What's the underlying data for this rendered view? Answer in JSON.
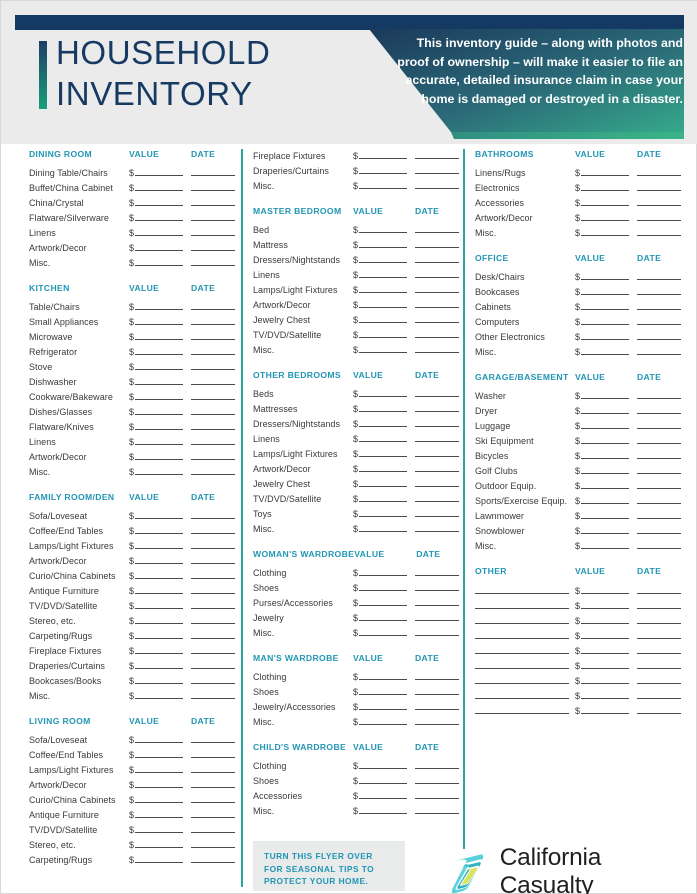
{
  "header": {
    "title_lines": [
      "HOUSEHOLD",
      "INVENTORY"
    ],
    "promo_text": "This inventory guide – along with photos and proof of ownership – will make it easier to file an accurate, detailed insurance claim in case your home is damaged or destroyed in a disaster.",
    "colors": {
      "band": "#ebebeb",
      "topbar_navy": "#143a64",
      "title_navy": "#173a63",
      "accent_teal": "#2aa79b",
      "section_blue": "#2196b4",
      "promo_gradient_start": "#1b3a5c",
      "promo_gradient_end": "#32a086"
    }
  },
  "table_headers": {
    "value": "VALUE",
    "date": "DATE"
  },
  "money_symbol": "$",
  "columns": [
    {
      "id": "column-1",
      "sections": [
        {
          "title": "DINING ROOM",
          "show_headers": true,
          "items": [
            "Dining Table/Chairs",
            "Buffet/China Cabinet",
            "China/Crystal",
            "Flatware/Silverware",
            "Linens",
            "Artwork/Decor",
            "Misc."
          ]
        },
        {
          "title": "KITCHEN",
          "show_headers": true,
          "items": [
            "Table/Chairs",
            "Small Appliances",
            "Microwave",
            "Refrigerator",
            "Stove",
            "Dishwasher",
            "Cookware/Bakeware",
            "Dishes/Glasses",
            "Flatware/Knives",
            "Linens",
            "Artwork/Decor",
            "Misc."
          ]
        },
        {
          "title": "FAMILY ROOM/DEN",
          "show_headers": true,
          "items": [
            "Sofa/Loveseat",
            "Coffee/End Tables",
            "Lamps/Light Fixtures",
            "Artwork/Decor",
            "Curio/China Cabinets",
            "Antique Furniture",
            "TV/DVD/Satellite",
            "Stereo, etc.",
            "Carpeting/Rugs",
            "Fireplace Fixtures",
            "Draperies/Curtains",
            "Bookcases/Books",
            "Misc."
          ]
        },
        {
          "title": "LIVING ROOM",
          "show_headers": true,
          "items": [
            "Sofa/Loveseat",
            "Coffee/End Tables",
            "Lamps/Light Fixtures",
            "Artwork/Decor",
            "Curio/China Cabinets",
            "Antique Furniture",
            "TV/DVD/Satellite",
            "Stereo, etc.",
            "Carpeting/Rugs"
          ]
        }
      ]
    },
    {
      "id": "column-2",
      "sections": [
        {
          "title": "",
          "show_headers": false,
          "items": [
            "Fireplace Fixtures",
            "Draperies/Curtains",
            "Misc."
          ]
        },
        {
          "title": "MASTER BEDROOM",
          "show_headers": true,
          "items": [
            "Bed",
            "Mattress",
            "Dressers/Nightstands",
            "Linens",
            "Lamps/Light Fixtures",
            "Artwork/Decor",
            "Jewelry Chest",
            "TV/DVD/Satellite",
            "Misc."
          ]
        },
        {
          "title": "OTHER BEDROOMS",
          "show_headers": true,
          "items": [
            "Beds",
            "Mattresses",
            "Dressers/Nightstands",
            "Linens",
            "Lamps/Light Fixtures",
            "Artwork/Decor",
            "Jewelry Chest",
            "TV/DVD/Satellite",
            "Toys",
            "Misc."
          ]
        },
        {
          "title": "WOMAN'S WARDROBE",
          "show_headers": true,
          "items": [
            "Clothing",
            "Shoes",
            "Purses/Accessories",
            "Jewelry",
            "Misc."
          ]
        },
        {
          "title": "MAN'S WARDROBE",
          "show_headers": true,
          "items": [
            "Clothing",
            "Shoes",
            "Jewelry/Accessories",
            "Misc."
          ]
        },
        {
          "title": "CHILD'S WARDROBE",
          "show_headers": true,
          "items": [
            "Clothing",
            "Shoes",
            "Accessories",
            "Misc."
          ]
        }
      ]
    },
    {
      "id": "column-3",
      "sections": [
        {
          "title": "BATHROOMS",
          "show_headers": true,
          "items": [
            "Linens/Rugs",
            "Electronics",
            "Accessories",
            "Artwork/Decor",
            "Misc."
          ]
        },
        {
          "title": "OFFICE",
          "show_headers": true,
          "items": [
            "Desk/Chairs",
            "Bookcases",
            "Cabinets",
            "Computers",
            "Other Electronics",
            "Misc."
          ]
        },
        {
          "title": "GARAGE/BASEMENT",
          "show_headers": true,
          "items": [
            "Washer",
            "Dryer",
            "Luggage",
            "Ski Equipment",
            "Bicycles",
            "Golf Clubs",
            "Outdoor Equip.",
            "Sports/Exercise Equip.",
            "Lawnmower",
            "Snowblower",
            "Misc."
          ]
        },
        {
          "title": "OTHER",
          "show_headers": true,
          "blank_label_rows": 9,
          "items": [
            "",
            "",
            "",
            "",
            "",
            "",
            "",
            "",
            ""
          ]
        }
      ]
    }
  ],
  "footer": {
    "callout_lines": [
      "TURN THIS FLYER OVER",
      "FOR SEASONAL TIPS TO",
      "PROTECT YOUR HOME."
    ],
    "brand_name": "California Casualty",
    "logo_colors": {
      "outer": "#3fc6d4",
      "mid": "#2fb3b8",
      "inner": "#d7e05a"
    }
  }
}
